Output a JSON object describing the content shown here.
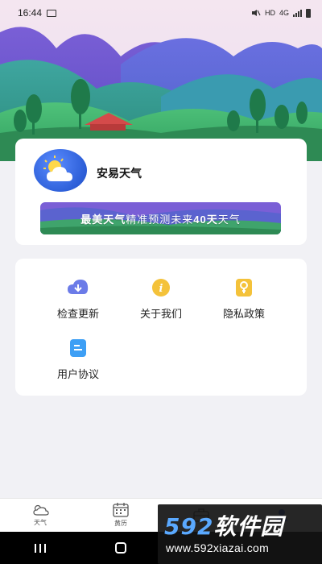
{
  "status_bar": {
    "time": "16:44",
    "hd": "HD",
    "network": "4G"
  },
  "app": {
    "name": "安易天气",
    "logo_icon": "sun-cloud-icon",
    "banner_bold": "最美天气",
    "banner_text": "精准预测未来",
    "banner_days": "40天",
    "banner_tail": "天气"
  },
  "menu": {
    "items": [
      {
        "label": "检查更新",
        "icon": "cloud-download-icon",
        "color": "#6b7be8"
      },
      {
        "label": "关于我们",
        "icon": "info-icon",
        "color": "#f4c23a"
      },
      {
        "label": "隐私政策",
        "icon": "lock-icon",
        "color": "#f4c23a"
      },
      {
        "label": "用户协议",
        "icon": "document-icon",
        "color": "#3d9ff5"
      }
    ]
  },
  "bottom_nav": {
    "items": [
      {
        "label": "天气",
        "icon": "weather-icon"
      },
      {
        "label": "黄历",
        "icon": "calendar-icon"
      },
      {
        "label": "",
        "icon": "toolbox-icon"
      },
      {
        "label": "",
        "icon": "user-icon"
      }
    ]
  },
  "watermark": {
    "logo_num": "592",
    "logo_cn": "软件园",
    "url": "www.592xiazai.com"
  },
  "colors": {
    "accent": "#3d6de0",
    "background": "#f1f1f5"
  }
}
